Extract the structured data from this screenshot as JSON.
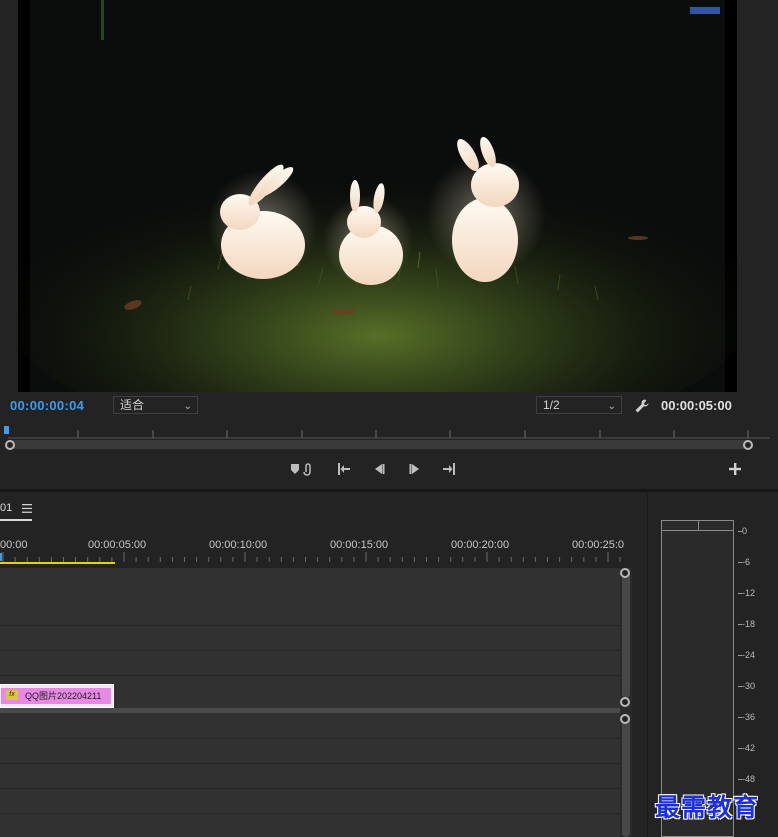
{
  "monitor": {
    "current_timecode": "00:00:00:04",
    "zoom": "适合",
    "resolution": "1/2",
    "duration_timecode": "00:00:05:00"
  },
  "timeline": {
    "sequence_tab": "01",
    "ruler_labels": [
      "00:00",
      "00:00:05:00",
      "00:00:10:00",
      "00:00:15:00",
      "00:00:20:00",
      "00:00:25:0"
    ],
    "clip": {
      "fx": "fx",
      "name": "QQ图片202204211"
    }
  },
  "meter": {
    "db_labels": [
      "0",
      "-6",
      "-12",
      "-18",
      "-24",
      "-30",
      "-36",
      "-42",
      "-48"
    ]
  },
  "watermark": "最需教育",
  "colors": {
    "accent": "#3b9cf0",
    "clip": "#e789e4",
    "playhead_bar": "#e6d400"
  }
}
